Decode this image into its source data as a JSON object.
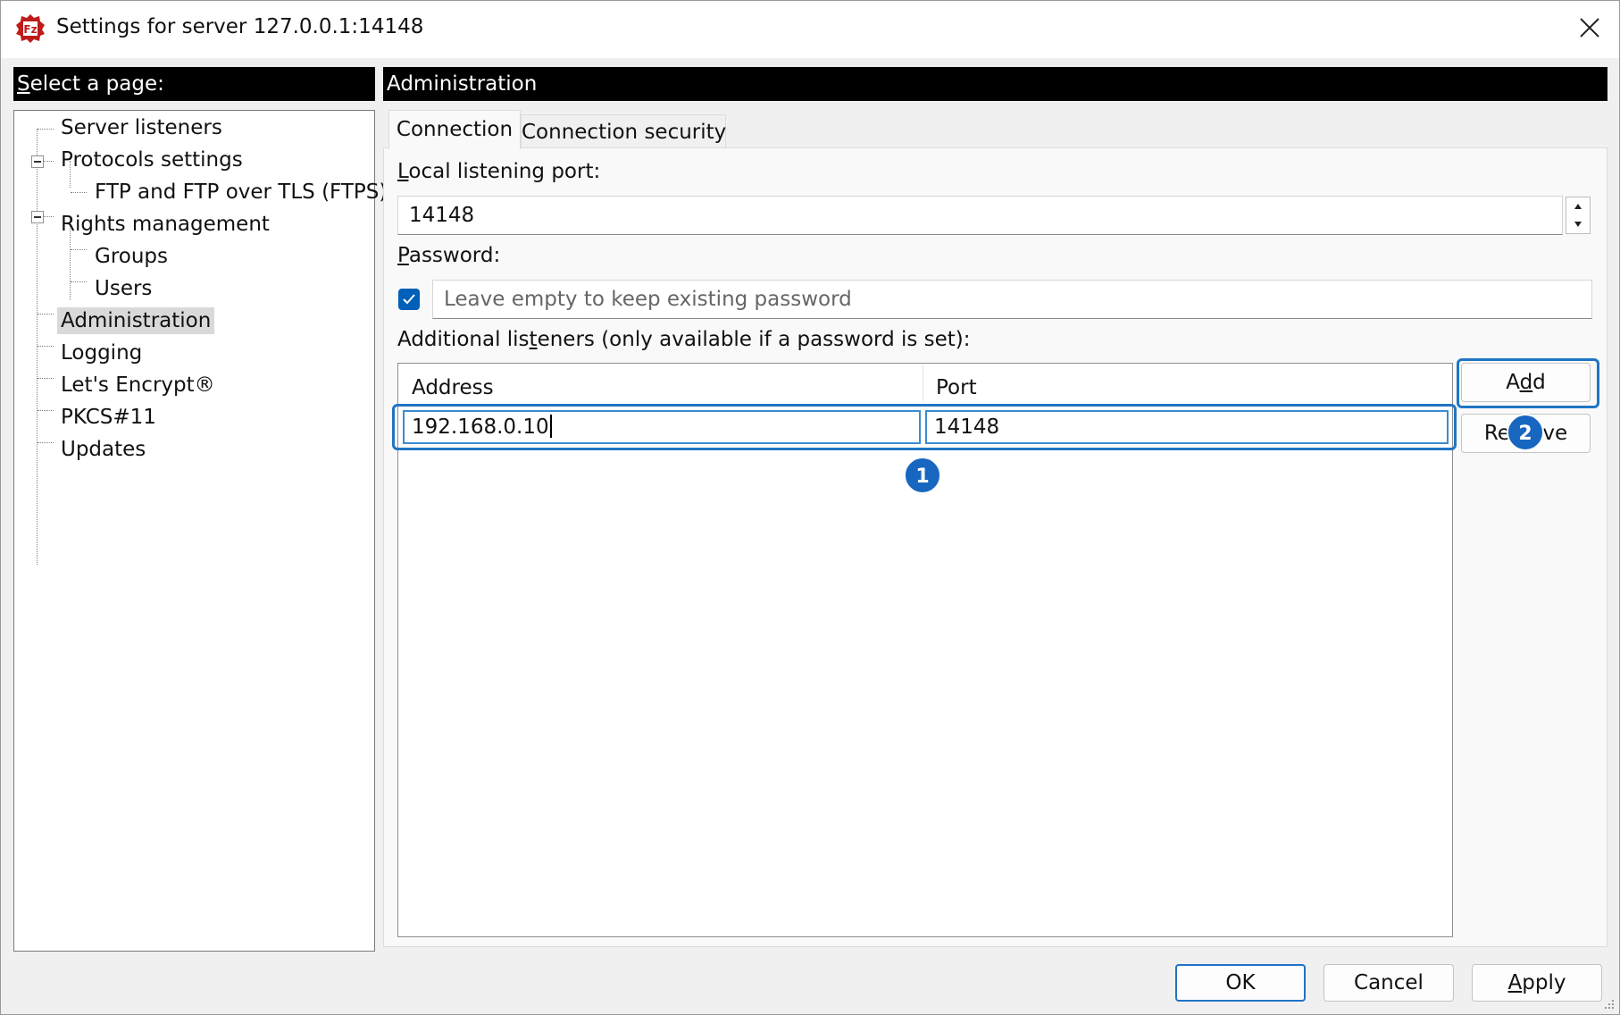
{
  "window": {
    "title": "Settings for server 127.0.0.1:14148"
  },
  "left": {
    "header": "Select a page:",
    "tree": [
      "Server listeners",
      "Protocols settings",
      "FTP and FTP over TLS (FTPS)",
      "Rights management",
      "Groups",
      "Users",
      "Administration",
      "Logging",
      "Let's Encrypt®",
      "PKCS#11",
      "Updates"
    ],
    "selected": "Administration"
  },
  "right": {
    "header": "Administration",
    "tabs": [
      "Connection",
      "Connection security"
    ],
    "active_tab": "Connection",
    "local_port_label": "Local listening port:",
    "local_port_value": "14148",
    "password_label": "Password:",
    "password_checked": true,
    "password_placeholder": "Leave empty to keep existing password",
    "listeners_label": "Additional listeners (only available if a password is set):",
    "columns": [
      "Address",
      "Port"
    ],
    "rows": [
      {
        "address": "192.168.0.10",
        "port": "14148"
      }
    ],
    "add_button": "Add",
    "remove_button": "Remove"
  },
  "annotations": [
    "1",
    "2"
  ],
  "footer": {
    "ok": "OK",
    "cancel": "Cancel",
    "apply": "Apply"
  },
  "colors": {
    "accent": "#005fb8",
    "highlight": "#1f75c4",
    "badge": "#1766c0",
    "header_bg": "#000000"
  }
}
